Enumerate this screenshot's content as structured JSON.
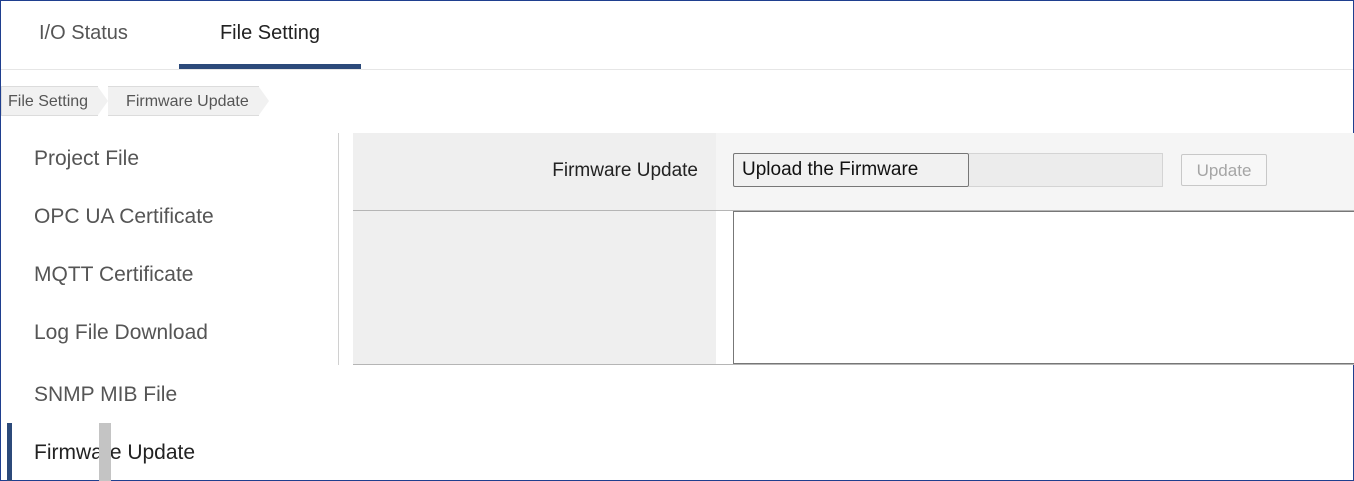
{
  "tabs": [
    {
      "label": "I/O Status",
      "active": false
    },
    {
      "label": "File Setting",
      "active": true
    }
  ],
  "breadcrumb": [
    "File Setting",
    "Firmware Update"
  ],
  "menu": [
    {
      "label": "Project File"
    },
    {
      "label": "OPC UA Certificate"
    },
    {
      "label": "MQTT Certificate"
    },
    {
      "label": "Log File Download"
    },
    {
      "label": "SNMP MIB File"
    },
    {
      "label": "Firmware Update",
      "active": true
    }
  ],
  "panel": {
    "label": "Firmware Update",
    "upload_button": "Upload the Firmware",
    "file_name": "",
    "update_button": "Update",
    "log_text": ""
  },
  "colors": {
    "accent": "#2c4a7a",
    "frame": "#1f3f8f",
    "label_bg": "#efefef"
  }
}
